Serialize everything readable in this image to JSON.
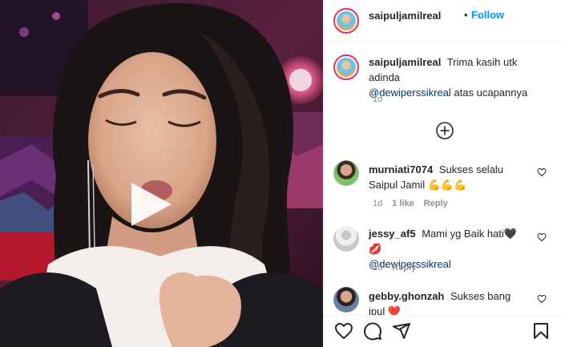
{
  "header": {
    "username": "saipuljamilreal",
    "separator": "•",
    "follow_label": "Follow"
  },
  "caption": {
    "username": "saipuljamilreal",
    "text": "Trima kasih utk adinda",
    "mention": "@dewiperssikreal",
    "text_after": "atas ucapannya",
    "time": "1d"
  },
  "load_more_icon": "plus-circle-icon",
  "comments": [
    {
      "username": "murniati7074",
      "text": "Sukses selalu Saipul Jamil 💪💪💪",
      "time": "1d",
      "likes": "1 like",
      "reply": "Reply"
    },
    {
      "username": "jessy_af5",
      "text": "Mami yg Baik hati🖤💋",
      "mention": "@dewiperssikreal",
      "time": "1d",
      "reply": "Reply"
    },
    {
      "username": "gebby.ghonzah",
      "text": "Sukses bang ipul ❤️"
    }
  ],
  "actions": [
    "heart-icon",
    "comment-icon",
    "share-icon",
    "save-icon"
  ],
  "colors": {
    "follow": "#0095f6",
    "mention": "#00376b",
    "story_ring": "#e1306c",
    "meta": "#8e8e8e"
  }
}
